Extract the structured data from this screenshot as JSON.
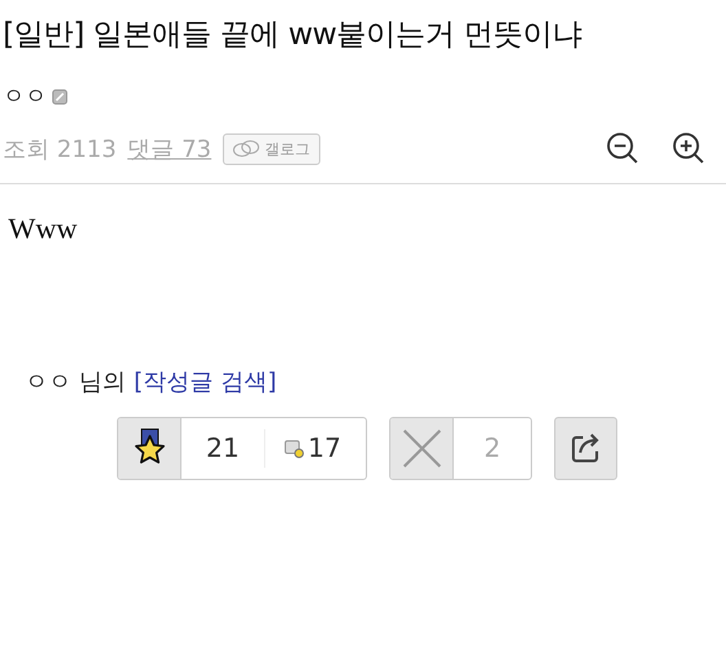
{
  "post": {
    "title": "[일반] 일본애들 끝에 ww붙이는거 먼뜻이냐",
    "author": "ㅇㅇ",
    "views_label": "조회 2113",
    "comments_link": "댓글 73",
    "gallog_button": "갤로그",
    "body": "Www",
    "writer_name": "ㅇㅇ 님의",
    "writer_search_link": "[작성글 검색]"
  },
  "reactions": {
    "recommend_count": "21",
    "fixed_recommend_count": "17",
    "downvote_count": "2"
  }
}
